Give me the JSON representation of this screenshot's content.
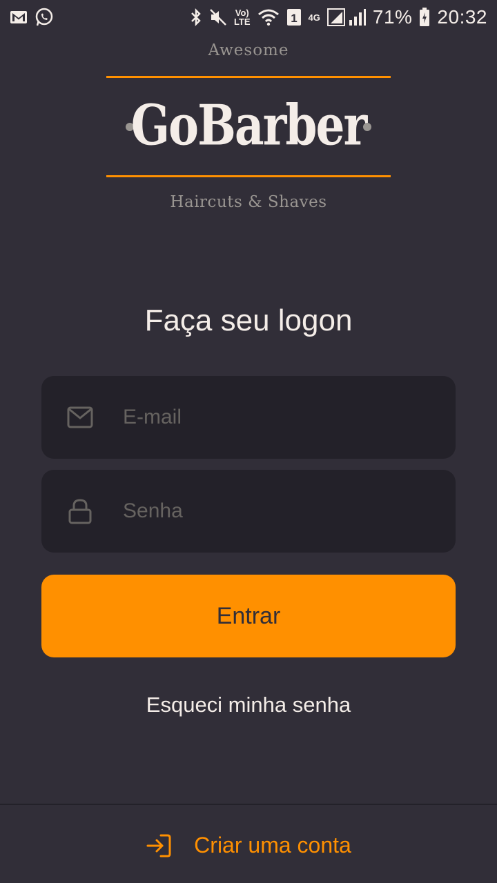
{
  "status_bar": {
    "battery": "71%",
    "time": "20:32",
    "volte_label": "VoLTE",
    "lte_label": "LTE",
    "network_label": "4G",
    "sim_label": "1",
    "icons": [
      "gmail-icon",
      "whatsapp-icon",
      "bluetooth-icon",
      "mute-icon",
      "volte-icon",
      "wifi-icon",
      "sim-icon",
      "signal-icon",
      "battery-icon"
    ]
  },
  "logo": {
    "top_text": "Awesome",
    "name": "GoBarber",
    "sub_text": "Haircuts & Shaves"
  },
  "login": {
    "title": "Faça seu logon",
    "email_placeholder": "E-mail",
    "email_value": "",
    "password_placeholder": "Senha",
    "password_value": "",
    "submit_label": "Entrar",
    "forgot_label": "Esqueci minha senha"
  },
  "footer": {
    "create_account_label": "Criar uma conta",
    "icon": "log-in-icon"
  },
  "colors": {
    "background": "#312e38",
    "input_background": "#232129",
    "accent": "#ff9000",
    "text": "#f4ede8",
    "placeholder": "#666360",
    "muted": "#999591"
  }
}
